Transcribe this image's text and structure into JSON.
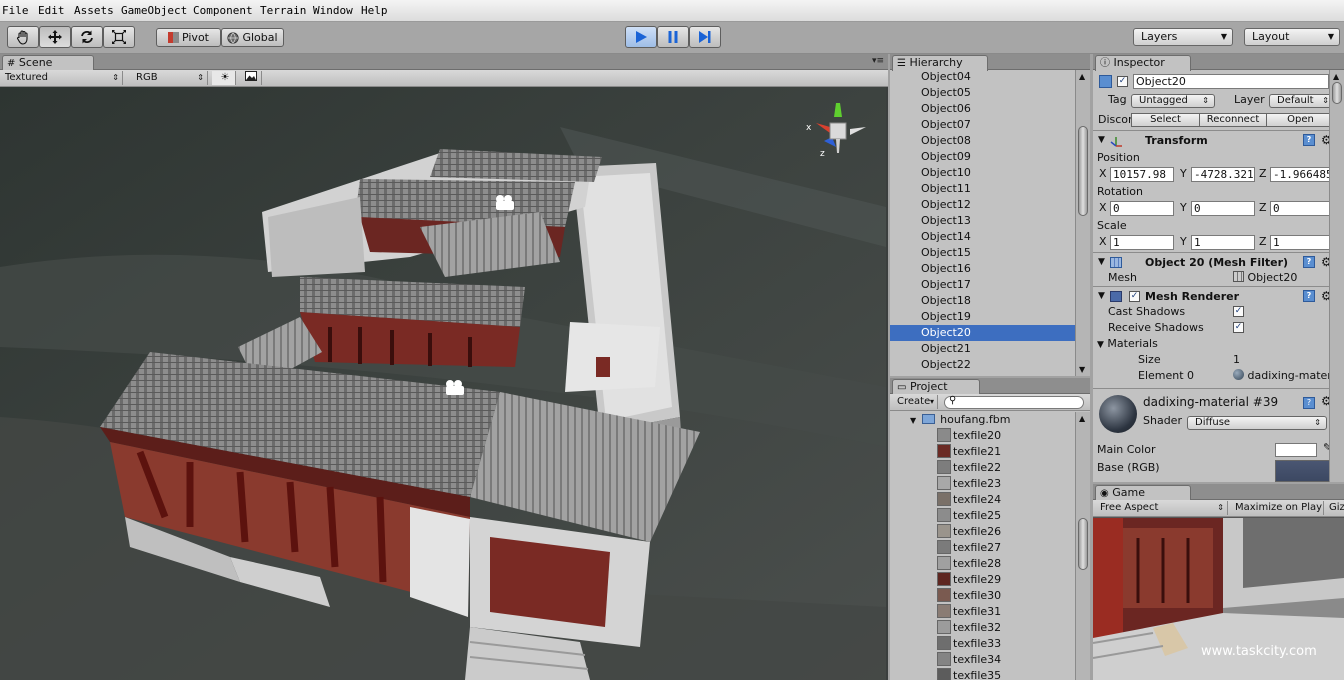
{
  "menubar": {
    "items": [
      "File",
      "Edit",
      "Assets",
      "GameObject",
      "Component",
      "Terrain",
      "Window",
      "Help"
    ]
  },
  "toolbar": {
    "pivot_label": "Pivot",
    "global_label": "Global",
    "layers_label": "Layers",
    "layout_label": "Layout"
  },
  "scene": {
    "tab_label": "Scene",
    "render_mode": "Textured",
    "channel": "RGB",
    "gizmo_axis_x": "x",
    "gizmo_axis_z": "z"
  },
  "hierarchy": {
    "tab_label": "Hierarchy",
    "items": [
      "Object04",
      "Object05",
      "Object06",
      "Object07",
      "Object08",
      "Object09",
      "Object10",
      "Object11",
      "Object12",
      "Object13",
      "Object14",
      "Object15",
      "Object16",
      "Object17",
      "Object18",
      "Object19",
      "Object20",
      "Object21",
      "Object22"
    ],
    "selected": "Object20"
  },
  "project": {
    "tab_label": "Project",
    "create_label": "Create",
    "search_placeholder": "",
    "folder": "houfang.fbm",
    "files": [
      "texfile20",
      "texfile21",
      "texfile22",
      "texfile23",
      "texfile24",
      "texfile25",
      "texfile26",
      "texfile27",
      "texfile28",
      "texfile29",
      "texfile30",
      "texfile31",
      "texfile32",
      "texfile33",
      "texfile34",
      "texfile35"
    ],
    "file_colors": [
      "#8a8a8a",
      "#6b2a24",
      "#7d7d7d",
      "#a8a8a8",
      "#7a7068",
      "#8c8c8c",
      "#9a948c",
      "#7b7b7b",
      "#a0a0a0",
      "#5e2620",
      "#7a5a50",
      "#8a7c74",
      "#9c9c9c",
      "#6e6e6e",
      "#848484",
      "#5c5c5c"
    ]
  },
  "inspector": {
    "tab_label": "Inspector",
    "object_name": "Object20",
    "tag_label": "Tag",
    "tag_value": "Untagged",
    "layer_label": "Layer",
    "layer_value": "Default",
    "prefab_label": "Discor",
    "select_label": "Select",
    "reconnect_label": "Reconnect",
    "open_label": "Open",
    "transform": {
      "title": "Transform",
      "position_label": "Position",
      "rotation_label": "Rotation",
      "scale_label": "Scale",
      "x": "X",
      "y": "Y",
      "z": "Z",
      "position": [
        "10157.98",
        "-4728.321",
        "-1.966485"
      ],
      "rotation": [
        "0",
        "0",
        "0"
      ],
      "scale": [
        "1",
        "1",
        "1"
      ]
    },
    "mesh_filter": {
      "title": "Object 20 (Mesh Filter)",
      "mesh_label": "Mesh",
      "mesh_value": "Object20"
    },
    "mesh_renderer": {
      "title": "Mesh Renderer",
      "cast_shadows_label": "Cast Shadows",
      "receive_shadows_label": "Receive Shadows",
      "materials_label": "Materials",
      "size_label": "Size",
      "size_value": "1",
      "element0_label": "Element 0",
      "element0_value": "dadixing-mater"
    },
    "material": {
      "title": "dadixing-material #39",
      "shader_label": "Shader",
      "shader_value": "Diffuse",
      "main_color_label": "Main Color",
      "base_label": "Base (RGB)"
    }
  },
  "game": {
    "tab_label": "Game",
    "aspect": "Free Aspect",
    "maximize_label": "Maximize on Play",
    "gizmos_label": "Gizr"
  },
  "watermark": "www.taskcity.com"
}
